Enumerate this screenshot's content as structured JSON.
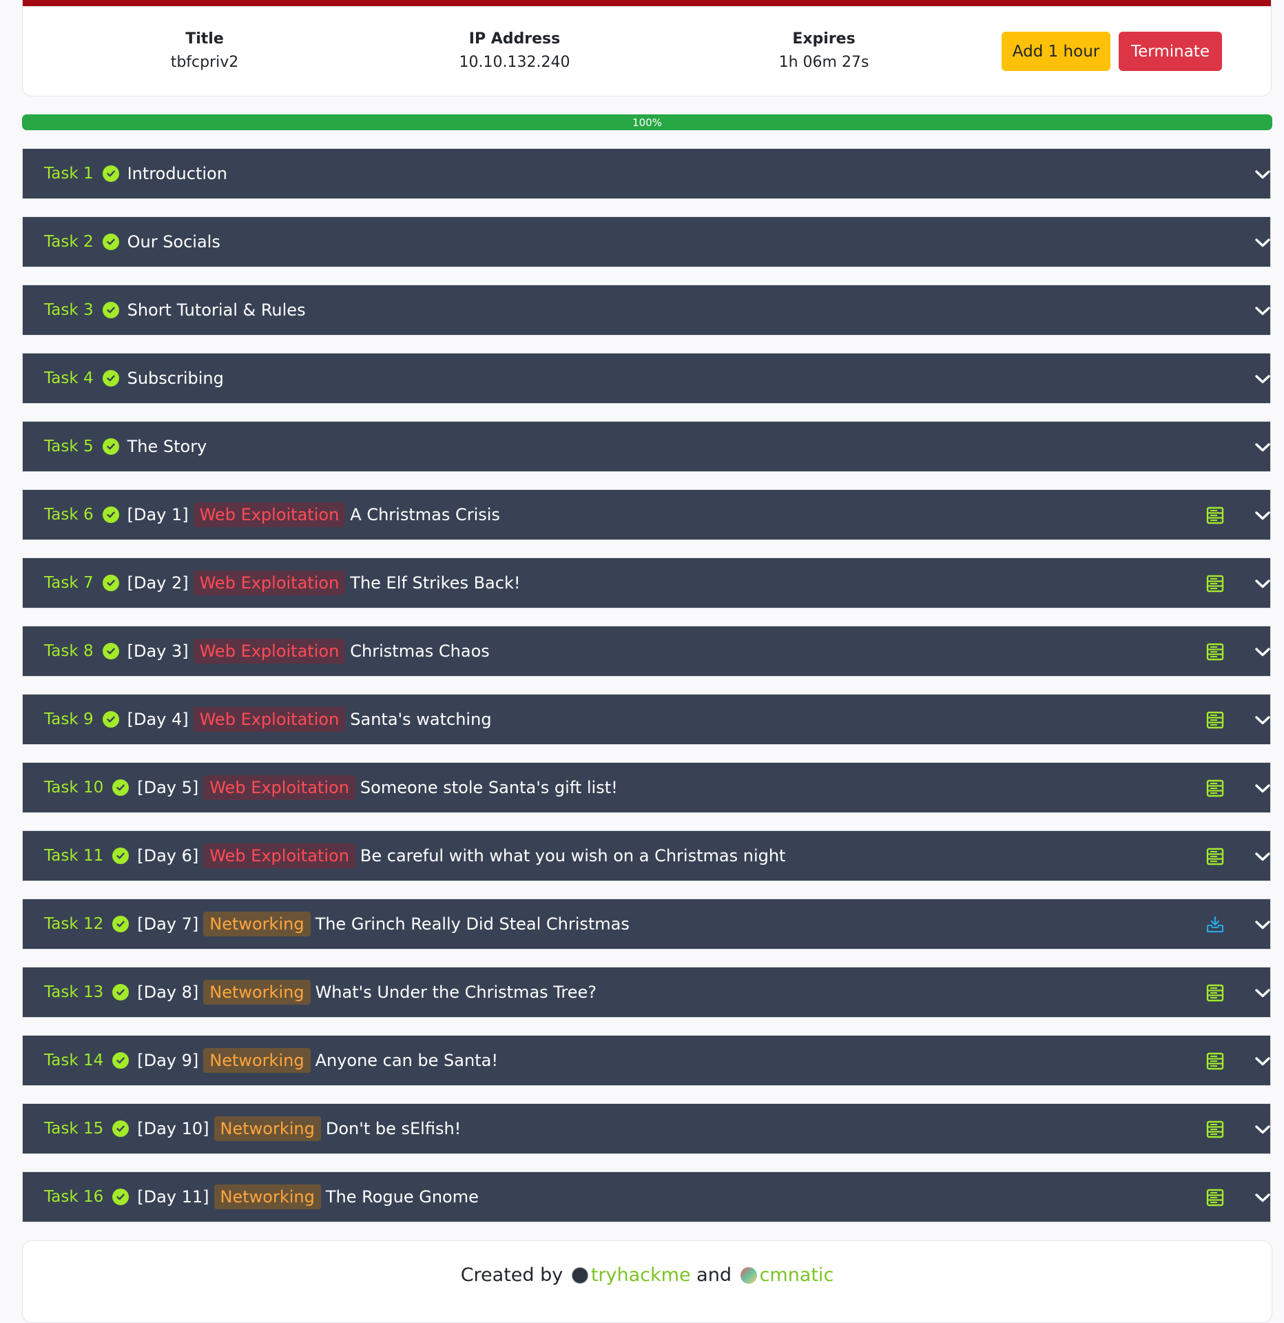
{
  "machine": {
    "title_label": "Title",
    "title_value": "tbfcpriv2",
    "ip_label": "IP Address",
    "ip_value": "10.10.132.240",
    "expires_label": "Expires",
    "expires_value": "1h 06m 27s",
    "add_hour_label": "Add 1 hour",
    "terminate_label": "Terminate"
  },
  "progress": {
    "text": "100%",
    "percent": 100
  },
  "tasks": [
    {
      "num": "Task 1",
      "day": "",
      "tag": "",
      "tag_type": "",
      "title": "Introduction",
      "icon": ""
    },
    {
      "num": "Task 2",
      "day": "",
      "tag": "",
      "tag_type": "",
      "title": "Our Socials",
      "icon": ""
    },
    {
      "num": "Task 3",
      "day": "",
      "tag": "",
      "tag_type": "",
      "title": "Short Tutorial & Rules",
      "icon": ""
    },
    {
      "num": "Task 4",
      "day": "",
      "tag": "",
      "tag_type": "",
      "title": "Subscribing",
      "icon": ""
    },
    {
      "num": "Task 5",
      "day": "",
      "tag": "",
      "tag_type": "",
      "title": "The Story",
      "icon": ""
    },
    {
      "num": "Task 6",
      "day": "[Day 1]",
      "tag": "Web Exploitation",
      "tag_type": "web",
      "title": "A Christmas Crisis",
      "icon": "server-icon"
    },
    {
      "num": "Task 7",
      "day": "[Day 2]",
      "tag": "Web Exploitation",
      "tag_type": "web",
      "title": "The Elf Strikes Back!",
      "icon": "server-icon"
    },
    {
      "num": "Task 8",
      "day": "[Day 3]",
      "tag": "Web Exploitation",
      "tag_type": "web",
      "title": "Christmas Chaos",
      "icon": "server-icon"
    },
    {
      "num": "Task 9",
      "day": "[Day 4]",
      "tag": "Web Exploitation",
      "tag_type": "web",
      "title": "Santa's watching",
      "icon": "server-icon"
    },
    {
      "num": "Task 10",
      "day": "[Day 5]",
      "tag": "Web Exploitation",
      "tag_type": "web",
      "title": "Someone stole Santa's gift list!",
      "icon": "server-icon"
    },
    {
      "num": "Task 11",
      "day": "[Day 6]",
      "tag": "Web Exploitation",
      "tag_type": "web",
      "title": "Be careful with what you wish on a Christmas night",
      "icon": "server-icon"
    },
    {
      "num": "Task 12",
      "day": "[Day 7]",
      "tag": "Networking",
      "tag_type": "net",
      "title": "The Grinch Really Did Steal Christmas",
      "icon": "download-icon"
    },
    {
      "num": "Task 13",
      "day": "[Day 8]",
      "tag": "Networking",
      "tag_type": "net",
      "title": "What's Under the Christmas Tree?",
      "icon": "server-icon"
    },
    {
      "num": "Task 14",
      "day": "[Day 9]",
      "tag": "Networking",
      "tag_type": "net",
      "title": "Anyone can be Santa!",
      "icon": "server-icon"
    },
    {
      "num": "Task 15",
      "day": "[Day 10]",
      "tag": "Networking",
      "tag_type": "net",
      "title": "Don't be sElfish!",
      "icon": "server-icon"
    },
    {
      "num": "Task 16",
      "day": "[Day 11]",
      "tag": "Networking",
      "tag_type": "net",
      "title": "The Rogue Gnome",
      "icon": "server-icon"
    }
  ],
  "footer": {
    "created_by": "Created by",
    "author1": "tryhackme",
    "and": "and",
    "author2": "cmnatic"
  },
  "colors": {
    "task_bg": "#384254",
    "accent_green": "#a3ea2a",
    "web_tag": "#ff4b55",
    "net_tag": "#ffa53c",
    "download_icon": "#2ba4e0",
    "top_bar": "#a30912"
  }
}
